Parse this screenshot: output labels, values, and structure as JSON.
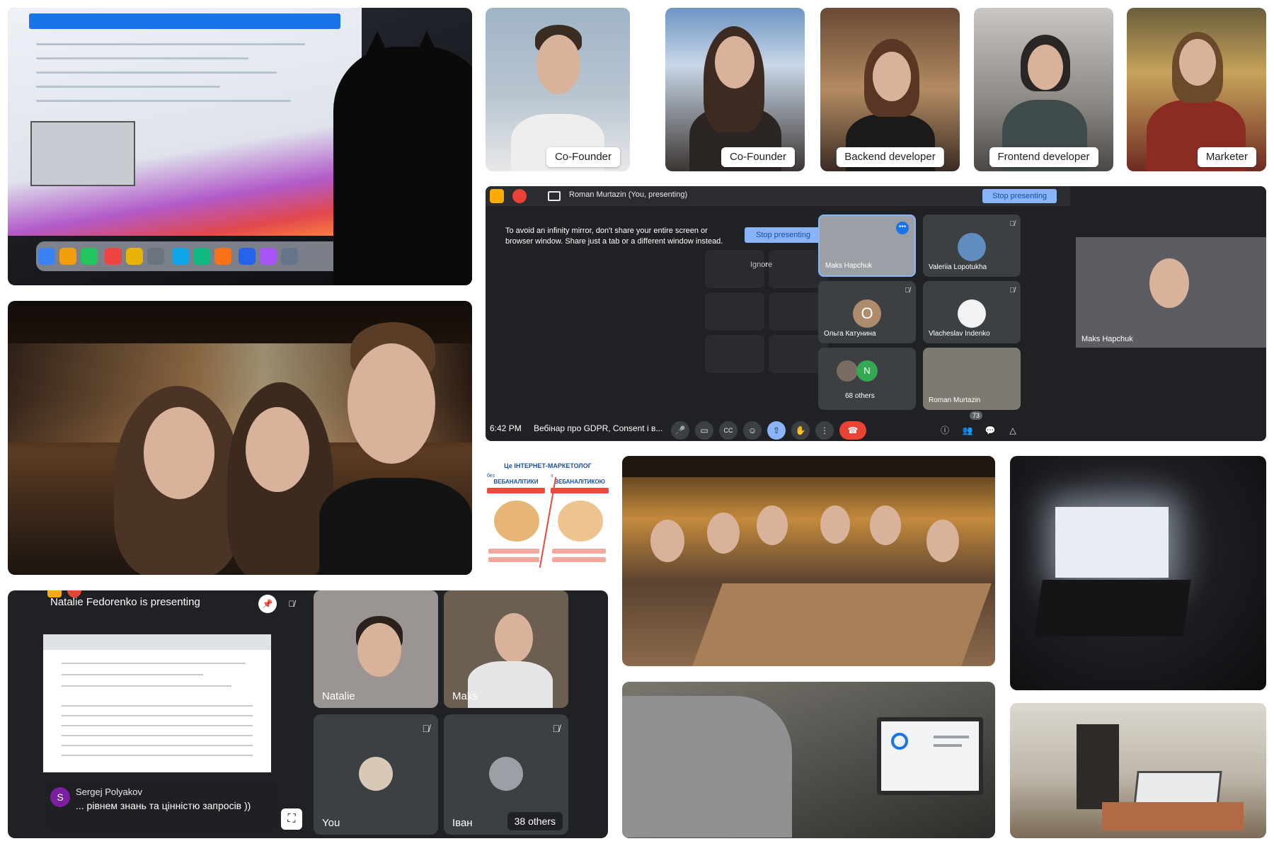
{
  "team_cards": [
    {
      "role": "Co-Founder"
    },
    {
      "role": "Co-Founder"
    },
    {
      "role": "Backend developer"
    },
    {
      "role": "Frontend developer"
    },
    {
      "role": "Marketer"
    }
  ],
  "meet_main": {
    "presenting_title": "Roman Murtazin (You, presenting)",
    "stop_presenting_top": "Stop presenting",
    "warning": "To avoid an infinity mirror, don't share your entire screen or browser window. Share just a tab or a different window instead.",
    "stop_presenting_dialog": "Stop presenting",
    "ignore": "Ignore",
    "participants": [
      {
        "name": "Maks Hapchuk"
      },
      {
        "name": "Valeriia Lopotukha"
      },
      {
        "name": "Ольга Катунина",
        "initial": "O"
      },
      {
        "name": "Vlacheslav Indenko"
      },
      {
        "name": "68 others",
        "initial": "N"
      },
      {
        "name": "Roman Murtazin"
      }
    ],
    "side_name": "Maks Hapchuk",
    "time": "6:42 PM",
    "meeting_title": "Вебінар про GDPR, Consent і в...",
    "participant_count": "73",
    "accent_color": "#8ab4f8",
    "end_color": "#ea4335"
  },
  "meet_bottom": {
    "presenting_title": "Natalie Fedorenko is presenting",
    "tiles": [
      {
        "name": "Natalie"
      },
      {
        "name": "Maks"
      },
      {
        "name": "You"
      },
      {
        "name": "Іван"
      }
    ],
    "others": "38 others",
    "chat_initial": "S",
    "chat_name": "Sergej Polyakov",
    "chat_message": "... рівнем знань та цінністю запросів ))"
  },
  "meme": {
    "title": "Це ІНТЕРНЕТ-МАРКЕТОЛОГ",
    "left_heading": "ВЕБАНАЛІТИКИ",
    "right_heading": "ВЕБАНАЛІТИКОЮ",
    "left_prefix": "без",
    "right_prefix": "з"
  }
}
